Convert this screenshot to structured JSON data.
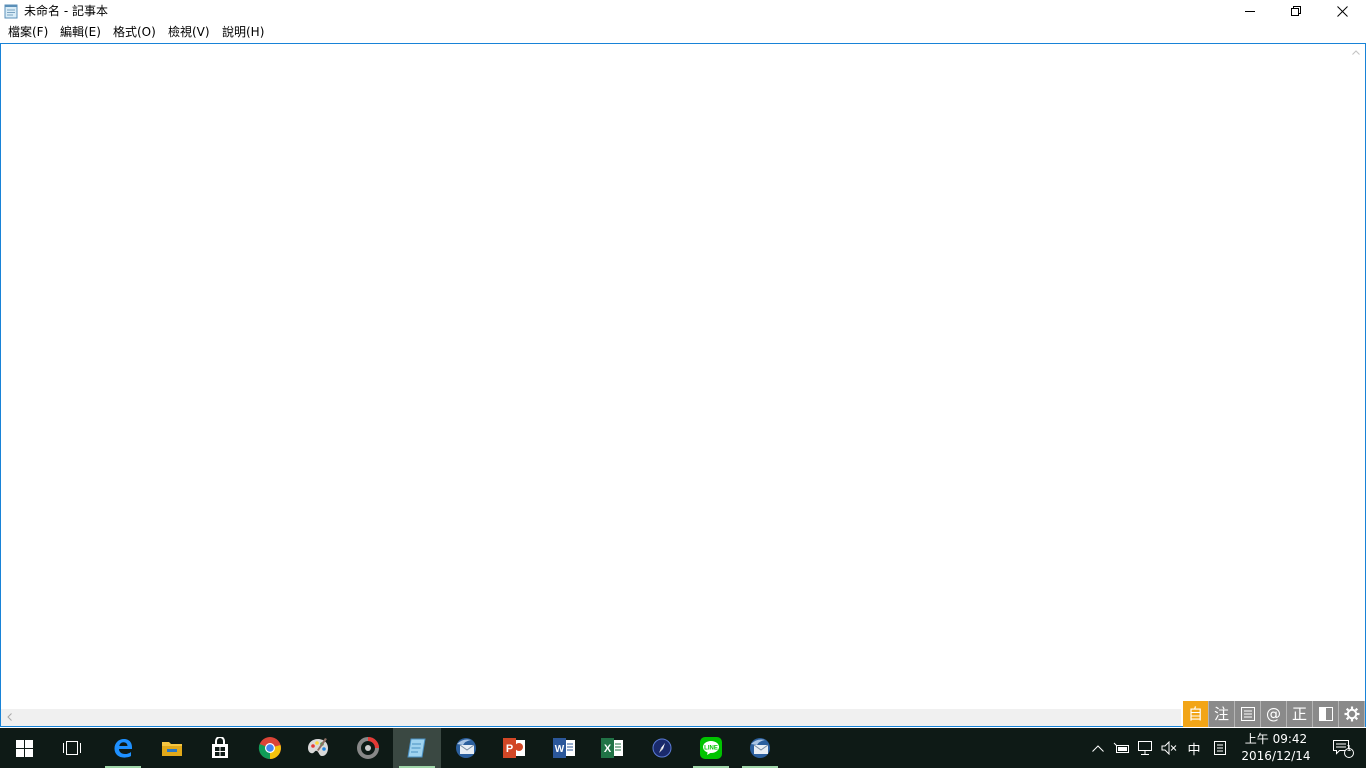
{
  "window": {
    "title": "未命名 - 記事本",
    "controls": {
      "minimize": "—",
      "maximize": "□",
      "close": "✕"
    }
  },
  "menu": {
    "items": [
      "檔案(F)",
      "編輯(E)",
      "格式(O)",
      "檢視(V)",
      "說明(H)"
    ]
  },
  "editor": {
    "content": ""
  },
  "ime": {
    "buttons": [
      "自",
      "注",
      "目",
      "@",
      "正",
      "◧",
      "⚙"
    ]
  },
  "taskbar": {
    "apps": [
      {
        "name": "start",
        "icon": "windows-logo-icon"
      },
      {
        "name": "task-view",
        "icon": "task-view-icon"
      },
      {
        "name": "edge",
        "icon": "edge-icon",
        "running": true
      },
      {
        "name": "file-explorer",
        "icon": "folder-icon"
      },
      {
        "name": "store",
        "icon": "store-icon"
      },
      {
        "name": "chrome",
        "icon": "chrome-icon"
      },
      {
        "name": "paint",
        "icon": "palette-icon"
      },
      {
        "name": "capture",
        "icon": "lens-icon"
      },
      {
        "name": "notepad",
        "icon": "notepad-icon",
        "running": true,
        "selected": true
      },
      {
        "name": "thunderbird",
        "icon": "mail-bird-icon"
      },
      {
        "name": "powerpoint",
        "icon": "powerpoint-icon"
      },
      {
        "name": "word",
        "icon": "word-icon"
      },
      {
        "name": "excel",
        "icon": "excel-icon"
      },
      {
        "name": "compass",
        "icon": "compass-icon"
      },
      {
        "name": "line",
        "icon": "line-icon",
        "running": true
      },
      {
        "name": "thunderbird-2",
        "icon": "mail-bird-icon",
        "running": true
      }
    ],
    "tray": {
      "ime_mode": "中",
      "clock_time": "上午 09:42",
      "clock_date": "2016/12/14",
      "notification_count": "1"
    }
  },
  "colors": {
    "editor_border": "#1883d7",
    "taskbar": "#0e1a16",
    "ime_active": "#f2a517",
    "ime_bg": "#8a8a8a"
  }
}
